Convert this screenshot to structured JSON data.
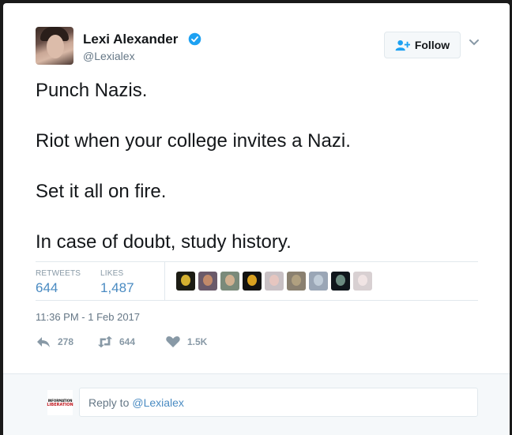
{
  "author": {
    "name": "Lexi Alexander",
    "handle": "@Lexialex",
    "verified": true,
    "follow_label": "Follow"
  },
  "tweet": {
    "lines": [
      "Punch Nazis.",
      "Riot when your college invites a Nazi.",
      "Set it all on fire.",
      "In case of doubt, study history."
    ]
  },
  "stats": {
    "retweets_label": "RETWEETS",
    "retweets_value": "644",
    "likes_label": "LIKES",
    "likes_value": "1,487",
    "likers": [
      {
        "icon": "liker-avatar-1",
        "bg": "#1c1c14",
        "fg": "#d4b030"
      },
      {
        "icon": "liker-avatar-2",
        "bg": "#6a5a6a",
        "fg": "#c28a6a"
      },
      {
        "icon": "liker-avatar-3",
        "bg": "#7a8a7a",
        "fg": "#d0b090"
      },
      {
        "icon": "liker-avatar-4",
        "bg": "#121212",
        "fg": "#d8a020"
      },
      {
        "icon": "liker-avatar-5",
        "bg": "#c8c0c4",
        "fg": "#e6c6c0"
      },
      {
        "icon": "liker-avatar-6",
        "bg": "#8a8070",
        "fg": "#b0a080"
      },
      {
        "icon": "liker-avatar-7",
        "bg": "#9aa6b6",
        "fg": "#c0ccd8"
      },
      {
        "icon": "liker-avatar-8",
        "bg": "#10161c",
        "fg": "#6a8a80"
      },
      {
        "icon": "liker-avatar-9",
        "bg": "#d8d0d2",
        "fg": "#f0e4e4"
      }
    ]
  },
  "timestamp": "11:36 PM - 1 Feb 2017",
  "actions": {
    "reply_count": "278",
    "retweet_count": "644",
    "like_count": "1.5K"
  },
  "reply_composer": {
    "my_avatar_line1": "INFORMATION",
    "my_avatar_line2": "LIBERATION",
    "prefix": "Reply to",
    "mention": "@Lexialex"
  },
  "colors": {
    "link": "#4a8bc2",
    "muted": "#8899a6",
    "text": "#14171a",
    "verified": "#1da1f2"
  }
}
